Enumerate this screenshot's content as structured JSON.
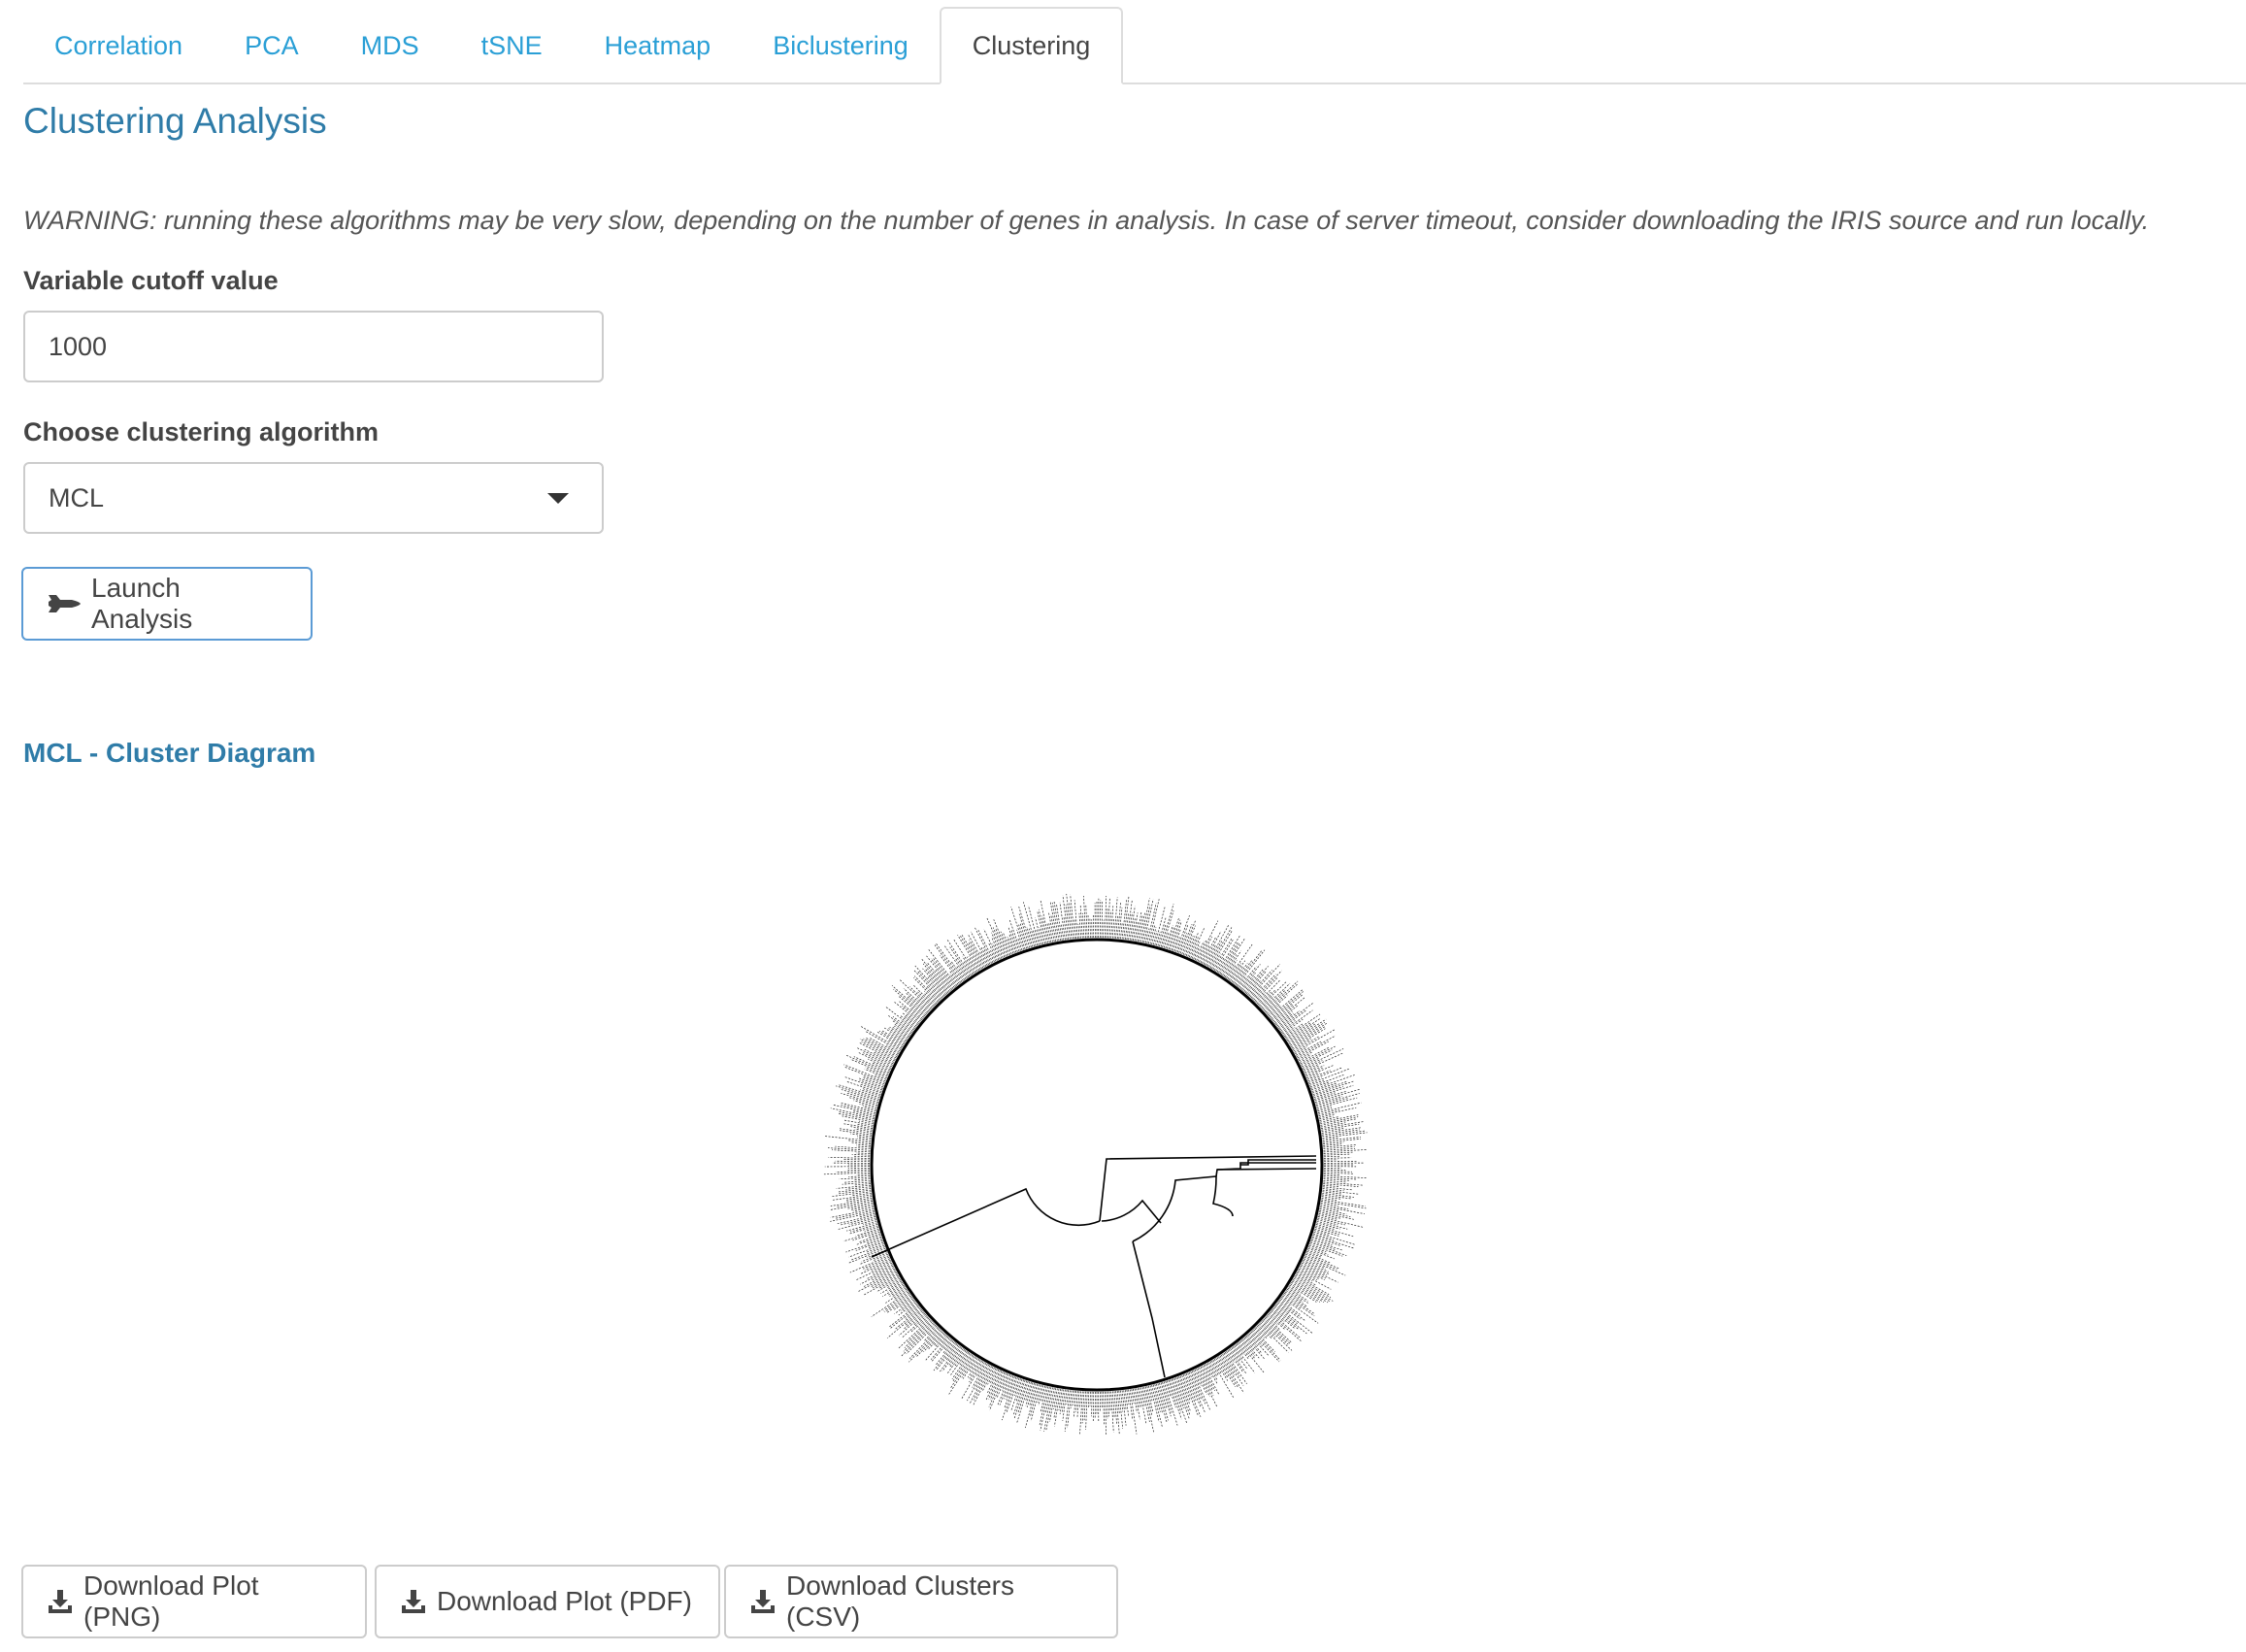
{
  "tabs": [
    {
      "label": "Correlation",
      "active": false
    },
    {
      "label": "PCA",
      "active": false
    },
    {
      "label": "MDS",
      "active": false
    },
    {
      "label": "tSNE",
      "active": false
    },
    {
      "label": "Heatmap",
      "active": false
    },
    {
      "label": "Biclustering",
      "active": false
    },
    {
      "label": "Clustering",
      "active": true
    }
  ],
  "page": {
    "title": "Clustering Analysis",
    "warning": "WARNING: running these algorithms may be very slow, depending on the number of genes in analysis. In case of server timeout, consider downloading the IRIS source and run locally."
  },
  "form": {
    "cutoff_label": "Variable cutoff value",
    "cutoff_value": "1000",
    "algorithm_label": "Choose clustering algorithm",
    "algorithm_value": "MCL",
    "launch_label": "Launch Analysis"
  },
  "result": {
    "title": "MCL - Cluster Diagram"
  },
  "downloads": {
    "png_label": "Download Plot (PNG)",
    "pdf_label": "Download Plot (PDF)",
    "csv_label": "Download Clusters (CSV)"
  },
  "icons": {
    "launch": "space-shuttle-icon",
    "download": "download-icon"
  },
  "colors": {
    "link": "#2a9fd6",
    "heading": "#2f7ca8",
    "text": "#444444"
  }
}
